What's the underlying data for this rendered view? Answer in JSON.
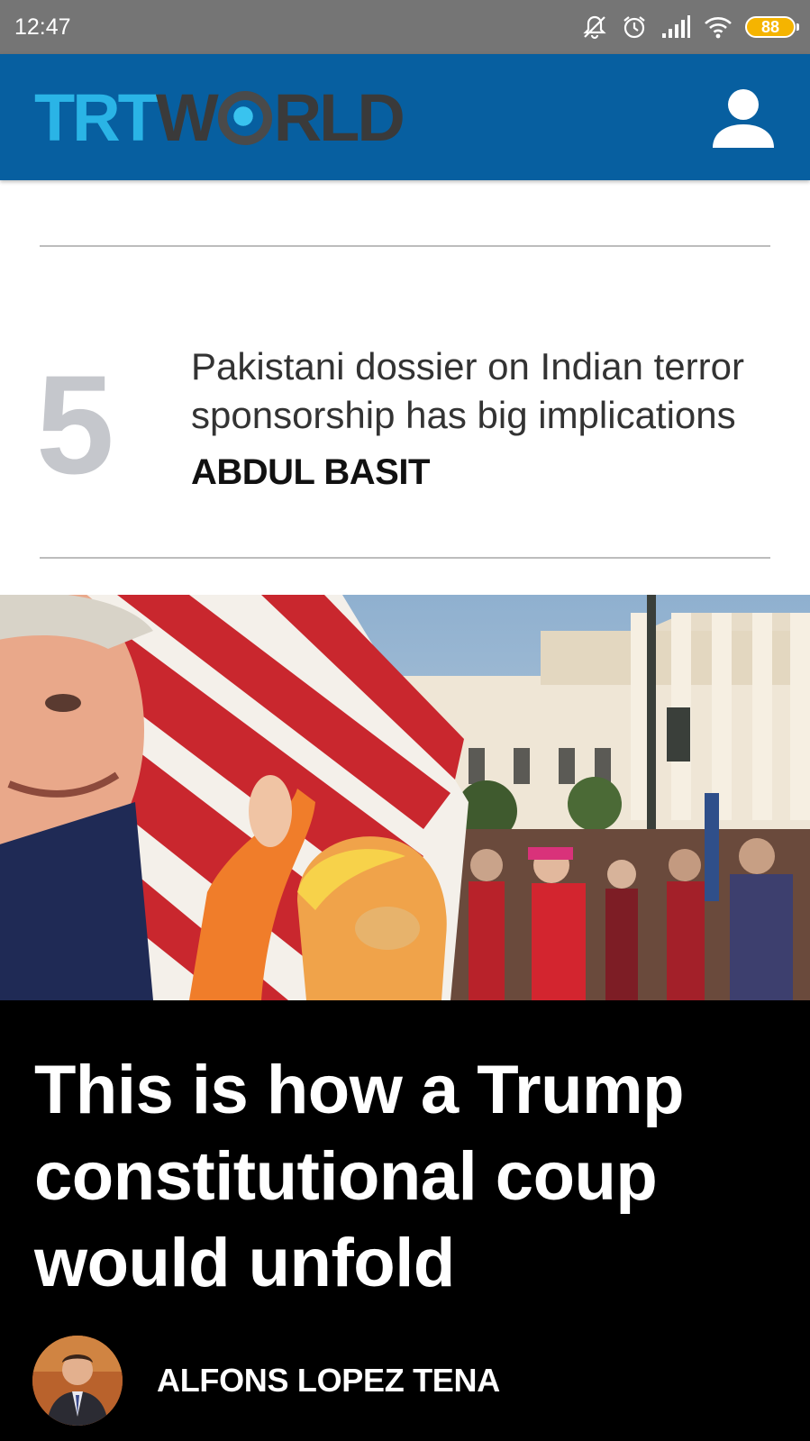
{
  "status_bar": {
    "time": "12:47",
    "battery": "88",
    "icons": [
      "notifications-off-icon",
      "alarm-icon",
      "signal-icon",
      "wifi-icon",
      "battery-icon"
    ]
  },
  "app_bar": {
    "logo_trt": "TRT",
    "logo_w": "W",
    "logo_rld": "RLD",
    "accent_color": "#075fa0",
    "logo_blue": "#2ab4e6"
  },
  "most_read": {
    "items": [
      {
        "rank": "5",
        "title_line1": "Pakistani dossier on Indian terror",
        "title_line2": "sponsorship has big implications",
        "author": "ABDUL BASIT"
      }
    ]
  },
  "featured": {
    "headline_line1": "This is how a Trump",
    "headline_line2": "constitutional coup",
    "headline_line3": "would unfold",
    "author": "ALFONS LOPEZ TENA"
  }
}
